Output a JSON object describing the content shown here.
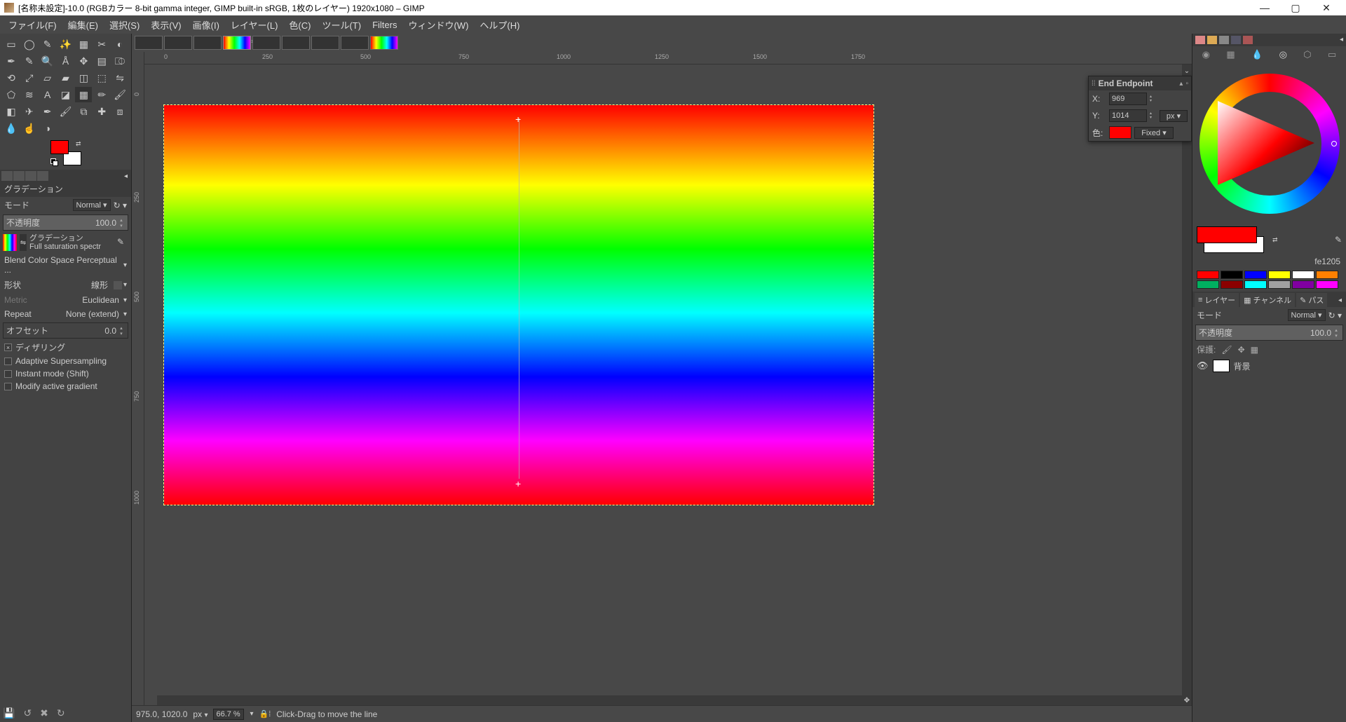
{
  "title": "[名称未設定]-10.0 (RGBカラー 8-bit gamma integer, GIMP built-in sRGB, 1枚のレイヤー) 1920x1080 – GIMP",
  "menus": [
    "ファイル(F)",
    "編集(E)",
    "選択(S)",
    "表示(V)",
    "画像(I)",
    "レイヤー(L)",
    "色(C)",
    "ツール(T)",
    "Filters",
    "ウィンドウ(W)",
    "ヘルプ(H)"
  ],
  "ruler_h": [
    "0",
    "250",
    "500",
    "750",
    "1000",
    "1250",
    "1500",
    "1750"
  ],
  "ruler_v": [
    "0",
    "250",
    "500",
    "750",
    "1000"
  ],
  "tool_options": {
    "title": "グラデーション",
    "mode_label": "モード",
    "mode_value": "Normal",
    "opacity_label": "不透明度",
    "opacity_value": "100.0",
    "gradient_label": "グラデーション",
    "gradient_name": "Full saturation spectr",
    "blend_label": "Blend Color Space Perceptual ...",
    "shape_label": "形状",
    "shape_value": "線形",
    "metric_label": "Metric",
    "metric_value": "Euclidean",
    "repeat_label": "Repeat",
    "repeat_value": "None (extend)",
    "offset_label": "オフセット",
    "offset_value": "0.0",
    "dither_label": "ディザリング",
    "supersample_label": "Adaptive Supersampling",
    "instant_label": "Instant mode  (Shift)",
    "modify_label": "Modify active gradient"
  },
  "overlay": {
    "title": "End Endpoint",
    "x_label": "X:",
    "x_value": "969",
    "y_label": "Y:",
    "y_value": "1014",
    "unit": "px",
    "color_label": "色:",
    "fixed": "Fixed"
  },
  "status": {
    "coords": "975.0, 1020.0",
    "unit": "px",
    "zoom": "66.7 %",
    "msg": "Click-Drag to move the line"
  },
  "right": {
    "hex": "fe1205",
    "swatches": [
      "#ff0000",
      "#000000",
      "#0000ff",
      "#ffff00",
      "#ffffff",
      "#ff8000",
      "#00b060",
      "#8b0000",
      "#00ffff",
      "#a0a0a0",
      "#8000a0",
      "#ff00ff"
    ],
    "tabs": [
      "レイヤー",
      "チャンネル",
      "パス"
    ],
    "mode_label": "モード",
    "mode_value": "Normal",
    "opacity_label": "不透明度",
    "opacity_value": "100.0",
    "protect_label": "保護:",
    "layer_name": "背景"
  }
}
